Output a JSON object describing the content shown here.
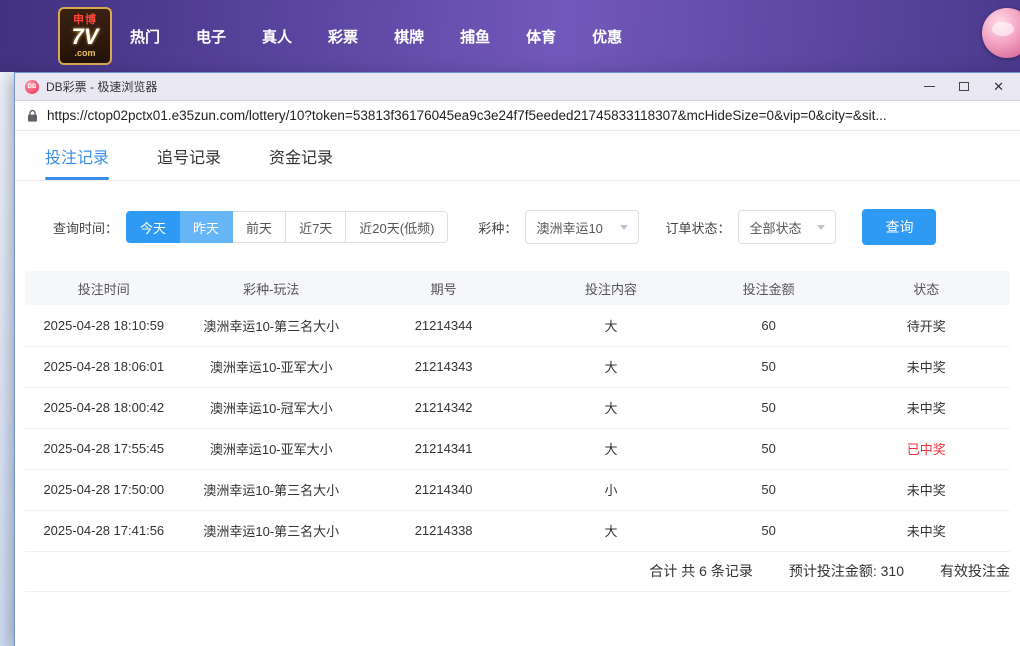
{
  "topnav": {
    "logo": {
      "line1": "申博",
      "line2": "7V",
      "line3": ".com"
    },
    "items": [
      {
        "label": "热门"
      },
      {
        "label": "电子"
      },
      {
        "label": "真人"
      },
      {
        "label": "彩票"
      },
      {
        "label": "棋牌"
      },
      {
        "label": "捕鱼"
      },
      {
        "label": "体育"
      },
      {
        "label": "优惠"
      }
    ]
  },
  "browser": {
    "icon_text": "DB",
    "title": "DB彩票 - 极速浏览器",
    "url": "https://ctop02pctx01.e35zun.com/lottery/10?token=53813f36176045ea9c3e24f7f5eeded21745833118307&mcHideSize=0&vip=0&city=&sit..."
  },
  "tabs": [
    {
      "label": "投注记录",
      "active": true
    },
    {
      "label": "追号记录",
      "active": false
    },
    {
      "label": "资金记录",
      "active": false
    }
  ],
  "filters": {
    "time_label": "查询时间：",
    "time_options": [
      {
        "label": "今天",
        "selected": "dark"
      },
      {
        "label": "昨天",
        "selected": "light"
      },
      {
        "label": "前天",
        "selected": "none"
      },
      {
        "label": "近7天",
        "selected": "none"
      },
      {
        "label": "近20天(低频)",
        "selected": "none"
      }
    ],
    "lottery_label": "彩种：",
    "lottery_value": "澳洲幸运10",
    "status_label": "订单状态：",
    "status_value": "全部状态",
    "search_label": "查询"
  },
  "table": {
    "headers": [
      "投注时间",
      "彩种-玩法",
      "期号",
      "投注内容",
      "投注金额",
      "状态"
    ],
    "rows": [
      {
        "time": "2025-04-28 18:10:59",
        "game": "澳洲幸运10-第三名大小",
        "issue": "21214344",
        "content": "大",
        "amount": "60",
        "status": "待开奖",
        "status_color": "normal"
      },
      {
        "time": "2025-04-28 18:06:01",
        "game": "澳洲幸运10-亚军大小",
        "issue": "21214343",
        "content": "大",
        "amount": "50",
        "status": "未中奖",
        "status_color": "normal"
      },
      {
        "time": "2025-04-28 18:00:42",
        "game": "澳洲幸运10-冠军大小",
        "issue": "21214342",
        "content": "大",
        "amount": "50",
        "status": "未中奖",
        "status_color": "normal"
      },
      {
        "time": "2025-04-28 17:55:45",
        "game": "澳洲幸运10-亚军大小",
        "issue": "21214341",
        "content": "大",
        "amount": "50",
        "status": "已中奖",
        "status_color": "red"
      },
      {
        "time": "2025-04-28 17:50:00",
        "game": "澳洲幸运10-第三名大小",
        "issue": "21214340",
        "content": "小",
        "amount": "50",
        "status": "未中奖",
        "status_color": "normal"
      },
      {
        "time": "2025-04-28 17:41:56",
        "game": "澳洲幸运10-第三名大小",
        "issue": "21214338",
        "content": "大",
        "amount": "50",
        "status": "未中奖",
        "status_color": "normal"
      }
    ],
    "summary": {
      "total": "合计 共 6 条记录",
      "expected": "预计投注金额: 310",
      "valid": "有效投注金"
    }
  }
}
